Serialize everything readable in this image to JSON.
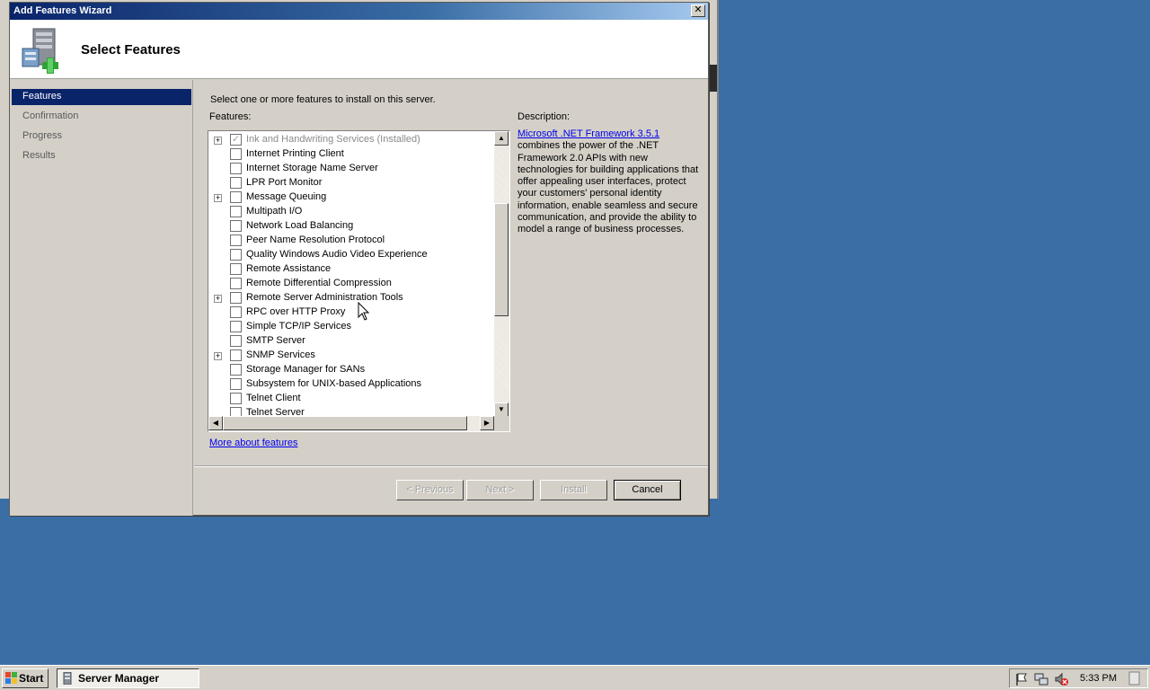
{
  "window": {
    "title": "Add Features Wizard",
    "close_glyph": "✕"
  },
  "header": {
    "title": "Select Features",
    "icon": "server-add-icon"
  },
  "nav": {
    "items": [
      {
        "label": "Features",
        "active": true
      },
      {
        "label": "Confirmation",
        "active": false
      },
      {
        "label": "Progress",
        "active": false
      },
      {
        "label": "Results",
        "active": false
      }
    ]
  },
  "main": {
    "instruction": "Select one or more features to install on this server.",
    "features_label": "Features:",
    "description_label": "Description:",
    "description_link": "Microsoft .NET Framework 3.5.1",
    "description_text": "combines the power of the .NET Framework 2.0 APIs with new technologies for building applications that offer appealing user interfaces, protect your customers' personal identity information, enable seamless and secure communication, and provide the ability to model a range of business processes.",
    "more_link": "More about features"
  },
  "features": [
    {
      "label": "Ink and Handwriting Services  (Installed)",
      "expandable": true,
      "checked": true,
      "disabled": true
    },
    {
      "label": "Internet Printing Client",
      "expandable": false,
      "checked": false,
      "disabled": false
    },
    {
      "label": "Internet Storage Name Server",
      "expandable": false,
      "checked": false,
      "disabled": false
    },
    {
      "label": "LPR Port Monitor",
      "expandable": false,
      "checked": false,
      "disabled": false
    },
    {
      "label": "Message Queuing",
      "expandable": true,
      "checked": false,
      "disabled": false
    },
    {
      "label": "Multipath I/O",
      "expandable": false,
      "checked": false,
      "disabled": false
    },
    {
      "label": "Network Load Balancing",
      "expandable": false,
      "checked": false,
      "disabled": false
    },
    {
      "label": "Peer Name Resolution Protocol",
      "expandable": false,
      "checked": false,
      "disabled": false
    },
    {
      "label": "Quality Windows Audio Video Experience",
      "expandable": false,
      "checked": false,
      "disabled": false
    },
    {
      "label": "Remote Assistance",
      "expandable": false,
      "checked": false,
      "disabled": false
    },
    {
      "label": "Remote Differential Compression",
      "expandable": false,
      "checked": false,
      "disabled": false
    },
    {
      "label": "Remote Server Administration Tools",
      "expandable": true,
      "checked": false,
      "disabled": false
    },
    {
      "label": "RPC over HTTP Proxy",
      "expandable": false,
      "checked": false,
      "disabled": false
    },
    {
      "label": "Simple TCP/IP Services",
      "expandable": false,
      "checked": false,
      "disabled": false
    },
    {
      "label": "SMTP Server",
      "expandable": false,
      "checked": false,
      "disabled": false
    },
    {
      "label": "SNMP Services",
      "expandable": true,
      "checked": false,
      "disabled": false
    },
    {
      "label": "Storage Manager for SANs",
      "expandable": false,
      "checked": false,
      "disabled": false
    },
    {
      "label": "Subsystem for UNIX-based Applications",
      "expandable": false,
      "checked": false,
      "disabled": false
    },
    {
      "label": "Telnet Client",
      "expandable": false,
      "checked": false,
      "disabled": false
    },
    {
      "label": "Telnet Server",
      "expandable": false,
      "checked": false,
      "disabled": false
    }
  ],
  "buttons": {
    "previous": "< Previous",
    "next": "Next >",
    "install": "Install",
    "cancel": "Cancel"
  },
  "taskbar": {
    "start": "Start",
    "task": "Server Manager",
    "clock": "5:33 PM"
  },
  "colors": {
    "desktop": "#3a6ea5",
    "selection": "#0a246a",
    "link": "#0000ee"
  }
}
